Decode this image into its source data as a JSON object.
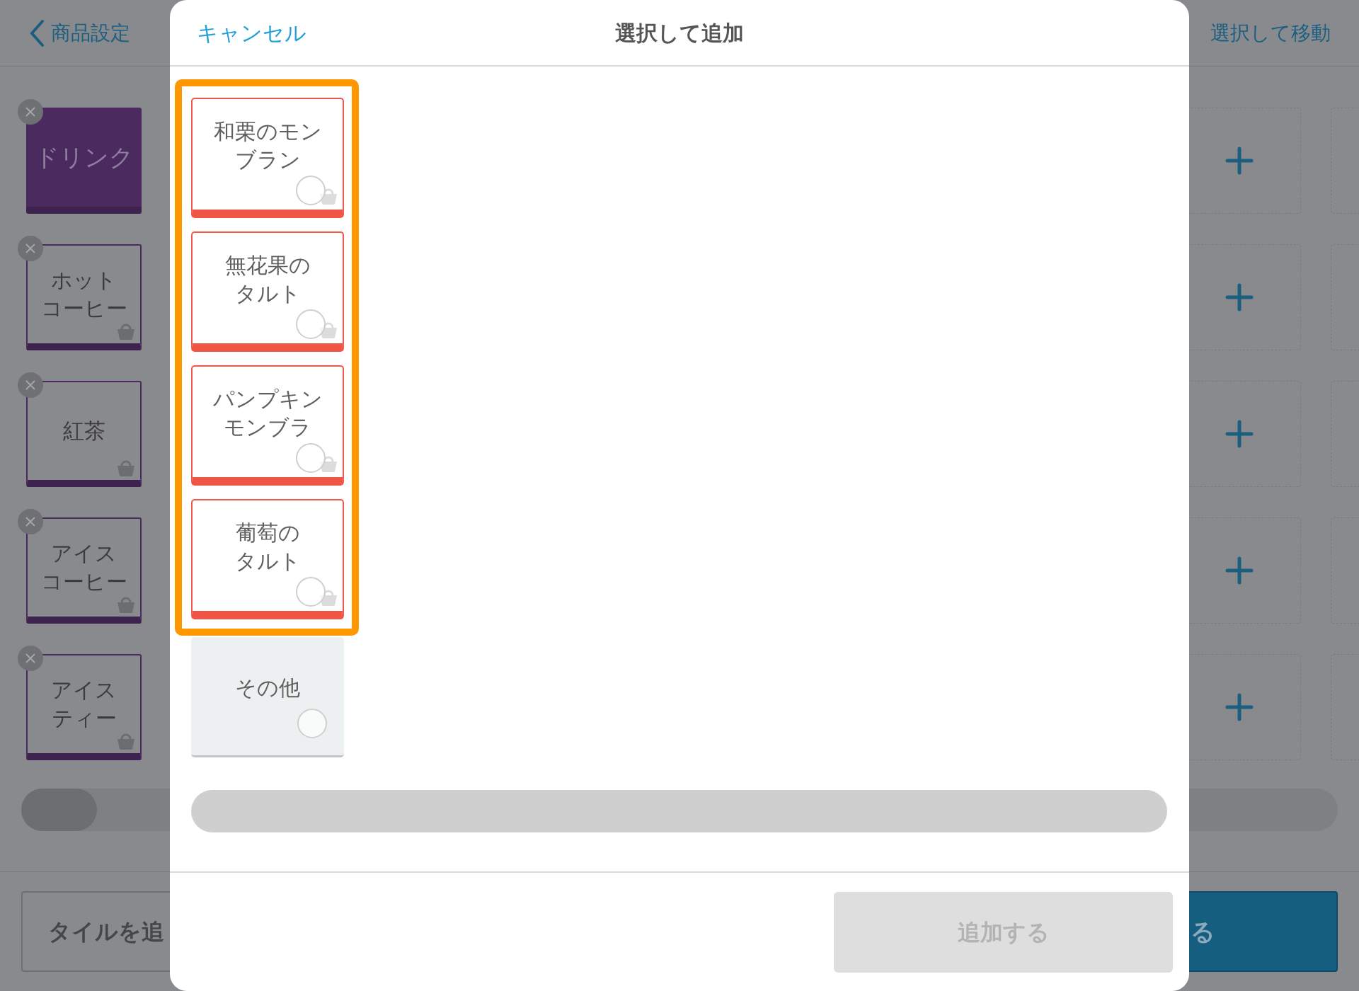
{
  "background": {
    "back_link": "商品設定",
    "right_action": "選択して移動",
    "tiles": [
      {
        "label_lines": [
          "ドリンク"
        ],
        "kind": "category"
      },
      {
        "label_lines": [
          "ホット",
          "コーヒー"
        ],
        "kind": "product"
      },
      {
        "label_lines": [
          "紅茶"
        ],
        "kind": "product"
      },
      {
        "label_lines": [
          "アイス",
          "コーヒー"
        ],
        "kind": "product"
      },
      {
        "label_lines": [
          "アイス",
          "ティー"
        ],
        "kind": "product"
      }
    ],
    "bottom_buttons": [
      {
        "label": "タイルを追",
        "kind": "outline"
      },
      {
        "label": "る",
        "kind": "primary"
      }
    ]
  },
  "modal": {
    "cancel": "キャンセル",
    "title": "選択して追加",
    "items": [
      {
        "label_lines": [
          "和栗のモン",
          "ブラン"
        ],
        "kind": "product",
        "selected": false,
        "highlighted": true
      },
      {
        "label_lines": [
          "無花果の",
          "タルト"
        ],
        "kind": "product",
        "selected": false,
        "highlighted": true
      },
      {
        "label_lines": [
          "パンプキン",
          "モンブラ"
        ],
        "kind": "product",
        "selected": false,
        "highlighted": true
      },
      {
        "label_lines": [
          "葡萄の",
          "タルト"
        ],
        "kind": "product",
        "selected": false,
        "highlighted": true
      },
      {
        "label_lines": [
          "その他"
        ],
        "kind": "category",
        "selected": false,
        "highlighted": false
      }
    ],
    "submit": {
      "label": "追加する",
      "disabled": true
    }
  }
}
